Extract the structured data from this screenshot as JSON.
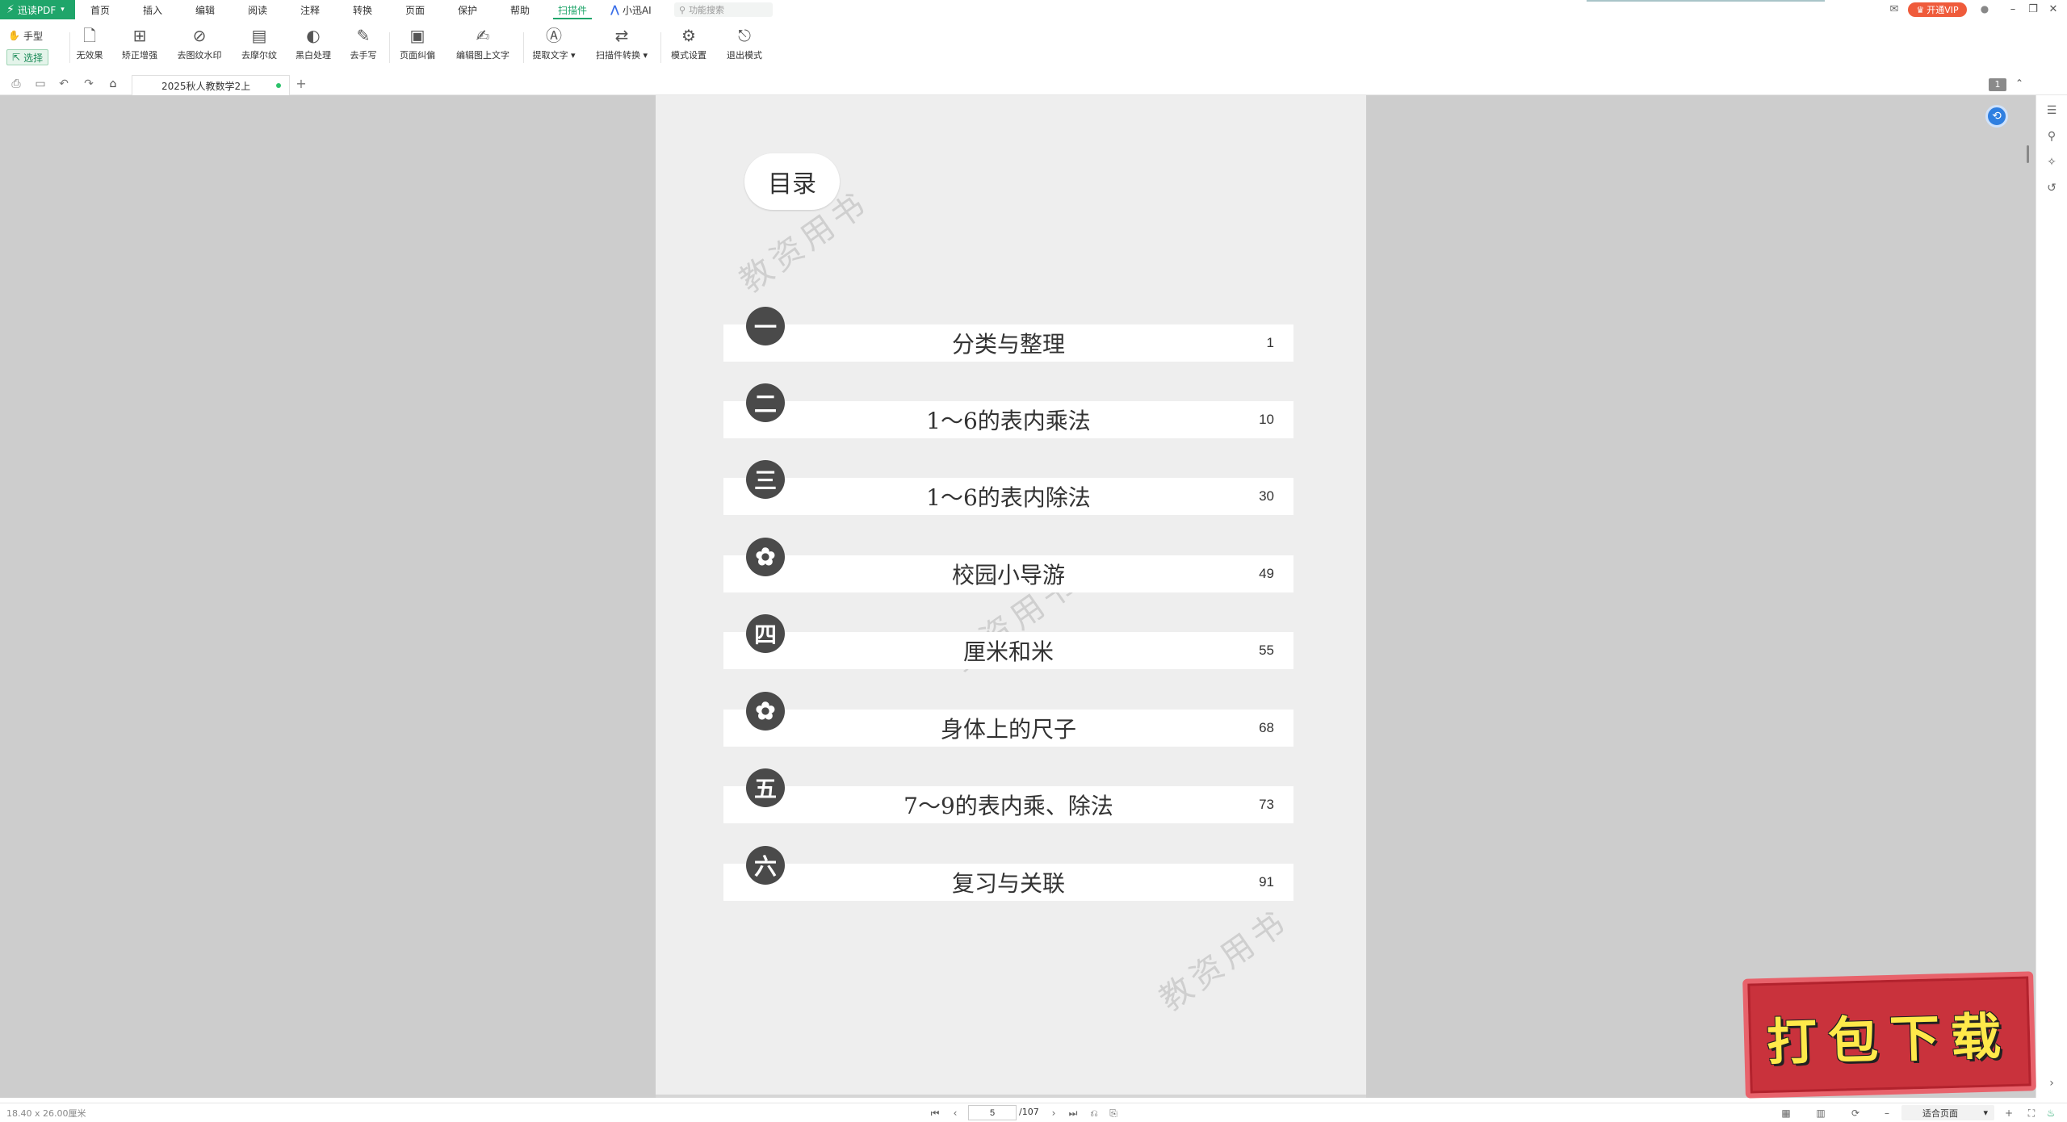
{
  "app": {
    "brand": "迅读PDF",
    "brand_icon": "lightning-bolt-icon",
    "accent": "#1fa56a"
  },
  "menu": {
    "tabs": [
      "首页",
      "插入",
      "编辑",
      "阅读",
      "注释",
      "转换",
      "页面",
      "保护",
      "帮助",
      "扫描件"
    ],
    "active": "扫描件",
    "ai_label": "小迅AI",
    "search_placeholder": "功能搜索"
  },
  "topright": {
    "vip_label": "开通VIP",
    "vip_color": "#ef5b3b"
  },
  "ribbon": {
    "hand_label": "手型",
    "select_label": "选择",
    "buttons": [
      {
        "label": "无效果",
        "icon": "no-effect-icon"
      },
      {
        "label": "矫正增强",
        "icon": "correct-enhance-icon"
      },
      {
        "label": "去图纹水印",
        "icon": "remove-watermark-icon"
      },
      {
        "label": "去摩尔纹",
        "icon": "remove-moire-icon"
      },
      {
        "label": "黑白处理",
        "icon": "black-white-icon"
      },
      {
        "label": "去手写",
        "icon": "remove-handwriting-icon"
      },
      {
        "label": "页面纠偏",
        "icon": "page-deskew-icon"
      },
      {
        "label": "编辑图上文字",
        "icon": "edit-image-text-icon"
      },
      {
        "label": "提取文字",
        "icon": "extract-text-icon"
      },
      {
        "label": "扫描件转换",
        "icon": "scan-convert-icon"
      },
      {
        "label": "模式设置",
        "icon": "mode-settings-icon"
      },
      {
        "label": "退出模式",
        "icon": "exit-mode-icon"
      }
    ]
  },
  "tabbar": {
    "doc_title": "2025秋人教数学2上",
    "page_badge": "1"
  },
  "page": {
    "toc_title": "目录",
    "watermark": "教资用书",
    "entries": [
      {
        "badge": "一",
        "title": "分类与整理",
        "page": "1"
      },
      {
        "badge": "二",
        "title": "1～6的表内乘法",
        "page": "10"
      },
      {
        "badge": "三",
        "title": "1～6的表内除法",
        "page": "30"
      },
      {
        "badge": "✿",
        "title": "校园小导游",
        "page": "49"
      },
      {
        "badge": "四",
        "title": "厘米和米",
        "page": "55"
      },
      {
        "badge": "✿",
        "title": "身体上的尺子",
        "page": "68"
      },
      {
        "badge": "五",
        "title": "7～9的表内乘、除法",
        "page": "73"
      },
      {
        "badge": "六",
        "title": "复习与关联",
        "page": "91"
      }
    ]
  },
  "stamp": {
    "text": "打包下载"
  },
  "statusbar": {
    "page_size": "18.40 x 26.00厘米",
    "current_page": "5",
    "total_pages": "/107",
    "zoom_label": "适合页面"
  }
}
